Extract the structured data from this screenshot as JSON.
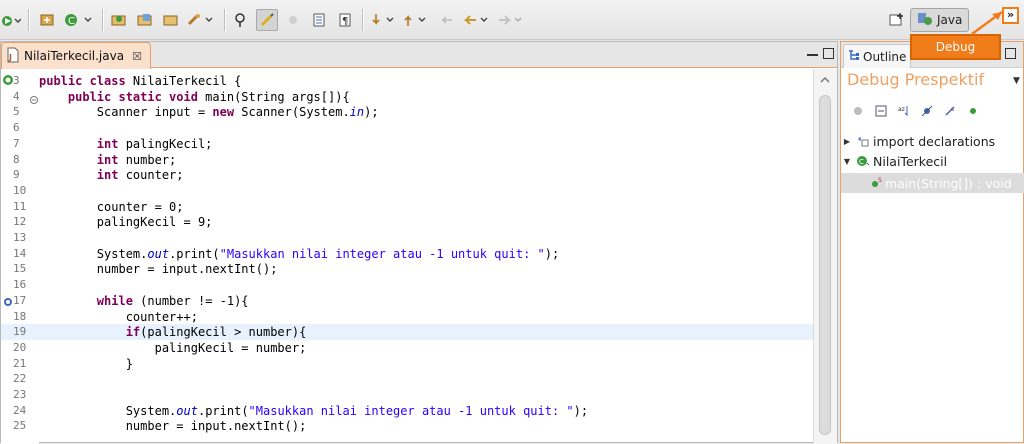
{
  "toolbar": {
    "icons": [
      "run-icon",
      "new-package-icon",
      "new-class-icon",
      "open-type-icon",
      "open-resource-icon",
      "open-task-icon",
      "search-icon",
      "toggle-mark-occurrences-icon",
      "toggle-highlight-icon",
      "show-whitespace-icon",
      "block-selection-icon",
      "next-annotation-icon",
      "prev-annotation-icon",
      "last-edit-icon",
      "back-icon",
      "forward-icon"
    ],
    "perspective_java": "Java",
    "perspective_popup": "Debug",
    "chevron": "»",
    "accent_color": "#f07c1a"
  },
  "editor": {
    "tab_title": "NilaiTerkecil.java",
    "tab_close": "☒",
    "lines": [
      {
        "n": "3",
        "parts": [
          [
            "kw",
            "public class"
          ],
          [
            "t",
            " NilaiTerkecil {"
          ]
        ]
      },
      {
        "n": "4",
        "parts": [
          [
            "t",
            "    "
          ],
          [
            "kw",
            "public static void"
          ],
          [
            "t",
            " main(String args[]){"
          ]
        ]
      },
      {
        "n": "5",
        "parts": [
          [
            "t",
            "        Scanner input = "
          ],
          [
            "kw",
            "new"
          ],
          [
            "t",
            " Scanner(System."
          ],
          [
            "st",
            "in"
          ],
          [
            "t",
            ");"
          ]
        ]
      },
      {
        "n": "6",
        "parts": []
      },
      {
        "n": "7",
        "parts": [
          [
            "t",
            "        "
          ],
          [
            "kw",
            "int"
          ],
          [
            "t",
            " palingKecil;"
          ]
        ]
      },
      {
        "n": "8",
        "parts": [
          [
            "t",
            "        "
          ],
          [
            "kw",
            "int"
          ],
          [
            "t",
            " number;"
          ]
        ]
      },
      {
        "n": "9",
        "parts": [
          [
            "t",
            "        "
          ],
          [
            "kw",
            "int"
          ],
          [
            "t",
            " counter;"
          ]
        ]
      },
      {
        "n": "10",
        "parts": []
      },
      {
        "n": "11",
        "parts": [
          [
            "t",
            "        counter = 0;"
          ]
        ]
      },
      {
        "n": "12",
        "parts": [
          [
            "t",
            "        palingKecil = 9;"
          ]
        ]
      },
      {
        "n": "13",
        "parts": []
      },
      {
        "n": "14",
        "parts": [
          [
            "t",
            "        System."
          ],
          [
            "st",
            "out"
          ],
          [
            "t",
            ".print("
          ],
          [
            "str",
            "\"Masukkan nilai integer atau -1 untuk quit: \""
          ],
          [
            "t",
            ");"
          ]
        ]
      },
      {
        "n": "15",
        "parts": [
          [
            "t",
            "        number = input.nextInt();"
          ]
        ]
      },
      {
        "n": "16",
        "parts": []
      },
      {
        "n": "17",
        "parts": [
          [
            "t",
            "        "
          ],
          [
            "kw",
            "while"
          ],
          [
            "t",
            " (number != -1){"
          ]
        ]
      },
      {
        "n": "18",
        "parts": [
          [
            "t",
            "            counter++;"
          ]
        ]
      },
      {
        "n": "19",
        "parts": [
          [
            "t",
            "            "
          ],
          [
            "kw",
            "if"
          ],
          [
            "t",
            "(palingKecil > number){"
          ]
        ]
      },
      {
        "n": "20",
        "parts": [
          [
            "t",
            "                palingKecil = number;"
          ]
        ]
      },
      {
        "n": "21",
        "parts": [
          [
            "t",
            "            }"
          ]
        ]
      },
      {
        "n": "22",
        "parts": []
      },
      {
        "n": "23",
        "parts": []
      },
      {
        "n": "24",
        "parts": [
          [
            "t",
            "            System."
          ],
          [
            "st",
            "out"
          ],
          [
            "t",
            ".print("
          ],
          [
            "str",
            "\"Masukkan nilai integer atau -1 untuk quit: \""
          ],
          [
            "t",
            ");"
          ]
        ]
      },
      {
        "n": "25",
        "parts": [
          [
            "t",
            "            number = input.nextInt();"
          ]
        ]
      }
    ],
    "current_line": "19"
  },
  "outline": {
    "tab_title": "Outline",
    "heading": "Debug Prespektif",
    "tree": [
      {
        "label": "import declarations",
        "kind": "imports",
        "twisty": "▶"
      },
      {
        "label": "NilaiTerkecil",
        "kind": "class",
        "twisty": "▼"
      },
      {
        "label": "main(String[]) : void",
        "kind": "method",
        "twisty": ""
      }
    ]
  }
}
